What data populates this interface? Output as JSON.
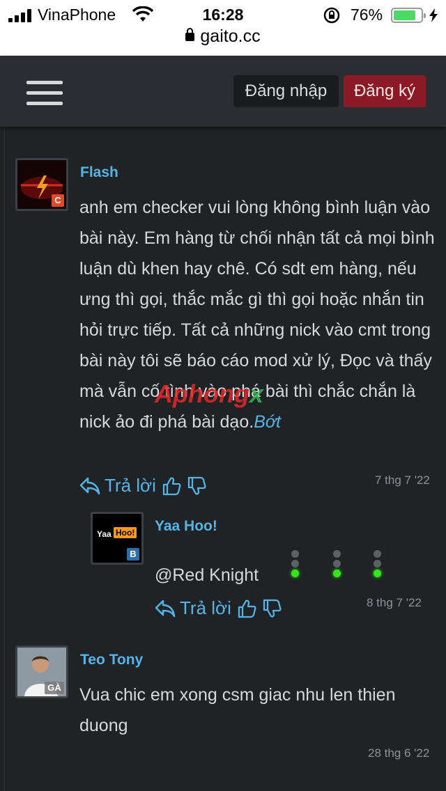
{
  "status_bar": {
    "carrier": "VinaPhone",
    "time": "16:28",
    "battery": "76%",
    "battery_level": 0.76,
    "url": "gaito.cc"
  },
  "header": {
    "login_label": "Đăng nhập",
    "register_label": "Đăng ký"
  },
  "partial_row": "/ Trả lời",
  "watermark": {
    "part1": "Aphong",
    "part2": "x"
  },
  "posts": [
    {
      "username": "Flash",
      "badge": "C",
      "text": "anh em checker vui lòng không bình luận vào bài này. Em hàng từ chối nhận tất cả mọi bình luận dù khen hay chê. Có sdt em hàng, nếu ưng thì gọi, thắc mắc gì thì gọi hoặc nhắn tin hỏi trực tiếp. Tất cả những nick vào cmt trong bài này tôi sẽ báo cáo mod xử lý, Đọc và thấy mà vẫn cố tình vào phá bài thì chắc chắn là nick ảo đi phá bài dạo.",
      "more_label": "Bớt",
      "reply_label": "Trả lời",
      "date": "7 thg 7 '22"
    },
    {
      "username": "Yaa Hoo!",
      "avatar_text_1": "Yaa",
      "avatar_text_2": "Hoo!",
      "badge": "B",
      "text": "@Red Knight",
      "reply_label": "Trả lời",
      "date": "8 thg 7 '22"
    },
    {
      "username": "Teo Tony",
      "badge": "GÀ",
      "text": "Vua chic em xong csm giac nhu len thien duong",
      "date": "28 thg 6 '22"
    }
  ],
  "colors": {
    "background": "#202326",
    "header": "#2a2e33",
    "link": "#56b3e8",
    "register": "#8b1a24",
    "traffic_light_on": "#33e81a"
  }
}
